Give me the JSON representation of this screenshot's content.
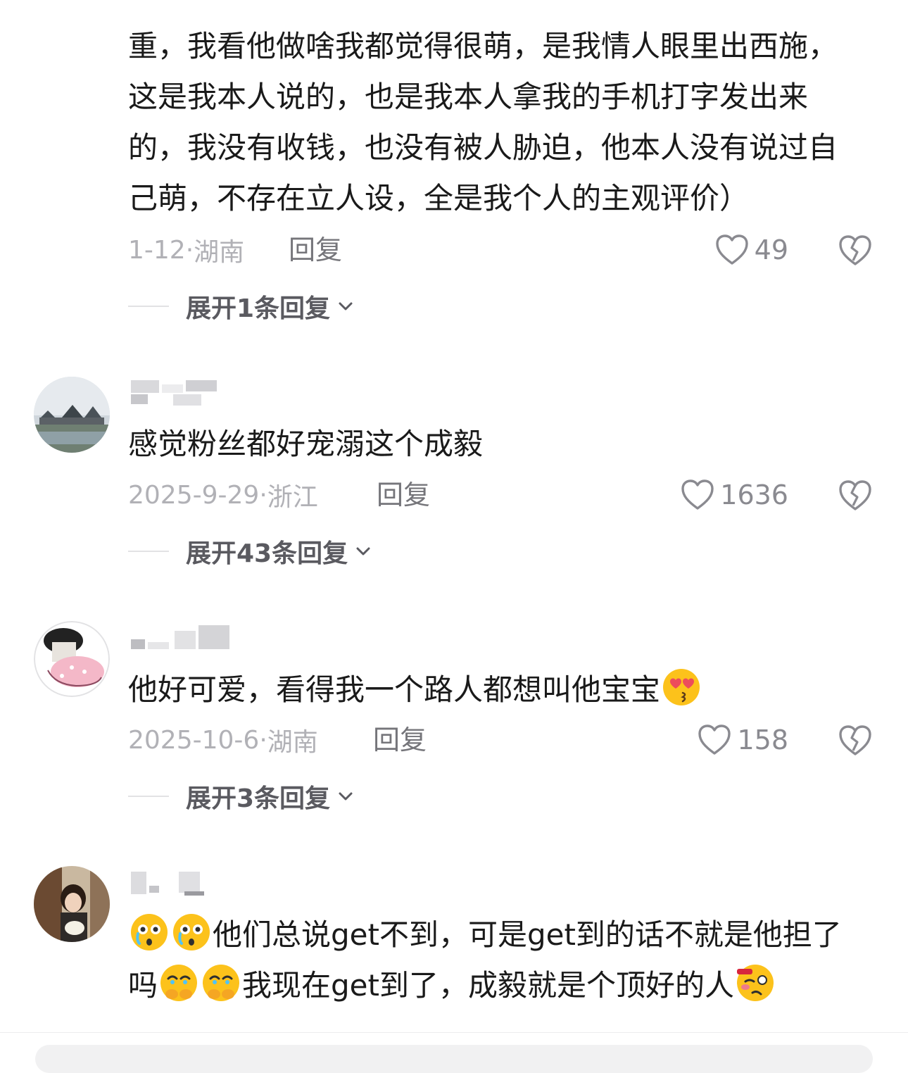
{
  "comments": [
    {
      "text_lines": [
        "重，我看他做啥我都觉得很萌，是我情人眼里出西施，",
        "这是我本人说的，也是我本人拿我的手机打字发出来",
        "的，我没有收钱，也没有被人胁迫，他本人没有说过自",
        "己萌，不存在立人设，全是我个人的主观评价）"
      ],
      "date": "1-12",
      "location": "湖南",
      "reply_label": "回复",
      "likes": "49",
      "expand_label": "展开1条回复"
    },
    {
      "text": "感觉粉丝都好宠溺这个成毅",
      "date": "2025-9-29",
      "location": "浙江",
      "reply_label": "回复",
      "likes": "1636",
      "expand_label": "展开43条回复"
    },
    {
      "text": "他好可爱，看得我一个路人都想叫他宝宝",
      "emoji_after": "heart-eyes-kiss-emoji",
      "date": "2025-10-6",
      "location": "湖南",
      "reply_label": "回复",
      "likes": "158",
      "expand_label": "展开3条回复"
    },
    {
      "line1": "他们总说get不到，可是get到的话不就是他担了",
      "line2a": "吗",
      "line2b": "我现在get到了，成毅就是个顶好的人",
      "emoji_names": [
        "flushed-crying-emoji",
        "holding-back-tears-emoji",
        "woozy-emoji"
      ]
    }
  ],
  "colors": {
    "text": "#1a1a1a",
    "meta": "#b1b1b6",
    "reply": "#75757a",
    "icon": "#8a8a90"
  },
  "icons": [
    "heart-outline-icon",
    "broken-heart-icon",
    "chevron-down-icon"
  ],
  "separator": "·"
}
